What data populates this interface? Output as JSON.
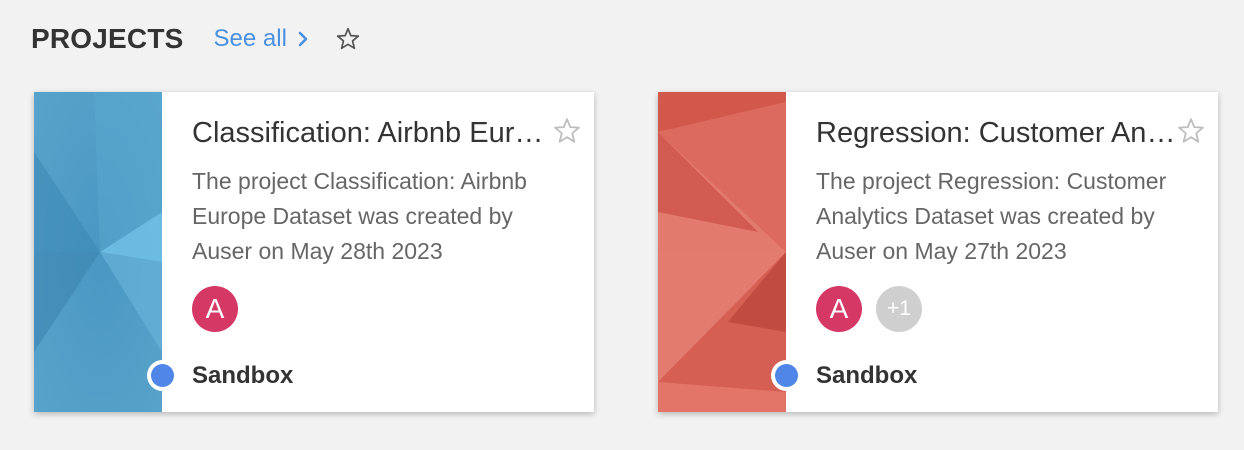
{
  "header": {
    "title": "PROJECTS",
    "see_all": "See all"
  },
  "projects": [
    {
      "title": "Classification: Airbnb Europe Dataset",
      "description": "The project Classification: Airbnb Europe Dataset was created by Auser on May 28th 2023",
      "avatars": [
        "A"
      ],
      "tag": "Sandbox",
      "thumb_colors": [
        "#3d8db8",
        "#6fbde2"
      ]
    },
    {
      "title": "Regression: Customer Analytics Dataset",
      "description": "The project Regression: Customer Analytics Dataset was created by Auser on May 27th 2023",
      "avatars": [
        "A",
        "+1"
      ],
      "tag": "Sandbox",
      "thumb_colors": [
        "#c0463b",
        "#e27468"
      ]
    }
  ],
  "colors": {
    "accent": "#4a90e2",
    "status_dot": "#4f86e8",
    "avatar": "#d63865"
  }
}
